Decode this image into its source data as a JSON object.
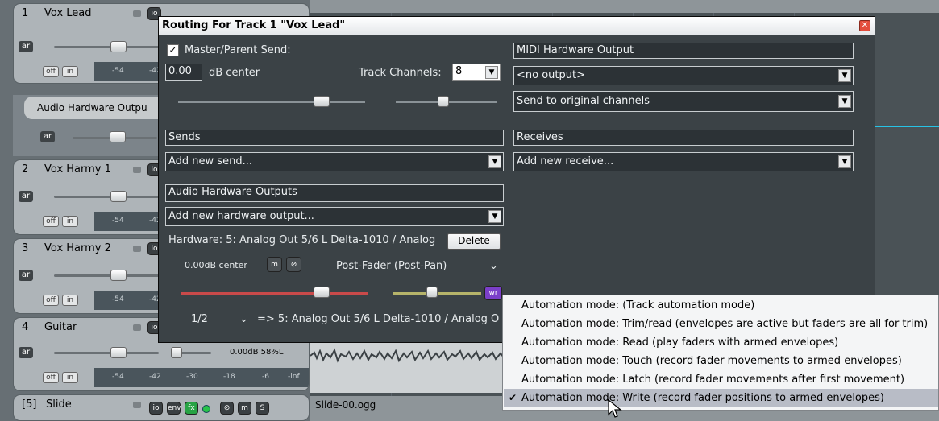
{
  "tracks": [
    {
      "num": "1",
      "name": "Vox Lead",
      "ar": "ar",
      "off": "off",
      "in": "in",
      "t1": "-54",
      "t2": "-42"
    },
    {
      "num": "2",
      "name": "Vox Harmy 1",
      "ar": "ar",
      "off": "off",
      "in": "in",
      "t1": "-54",
      "t2": "-42"
    },
    {
      "num": "3",
      "name": "Vox Harmy 2",
      "ar": "ar",
      "off": "off",
      "in": "in",
      "t1": "-54",
      "t2": "-42"
    },
    {
      "num": "4",
      "name": "Guitar",
      "ar": "ar",
      "off": "off",
      "in": "in",
      "meter": [
        "-54",
        "-42",
        "-30",
        "-18",
        "-6",
        "-inf"
      ],
      "vol": "0.00dB 58%L"
    },
    {
      "num": "[5]",
      "name": "Slide",
      "buttons": [
        "io",
        "env",
        "fx",
        "m",
        "S"
      ]
    }
  ],
  "hw_label": "Audio Hardware Outpu",
  "hw_ar": "ar",
  "slide_item": "Slide-00.ogg",
  "dialog": {
    "title": "Routing For Track 1 \"Vox Lead\"",
    "close": "✕",
    "master_send": "Master/Parent Send:",
    "vol_value": "0.00",
    "vol_unit": "dB  center",
    "track_channels_label": "Track Channels:",
    "track_channels": "8",
    "midi_hw_label": "MIDI Hardware Output",
    "midi_output": "<no output>",
    "midi_channels": "Send to original channels",
    "sends_label": "Sends",
    "sends_dd": "Add new send...",
    "receives_label": "Receives",
    "receives_dd": "Add new receive...",
    "audio_hw_label": "Audio Hardware Outputs",
    "audio_hw_dd": "Add new hardware output...",
    "hw_line": "Hardware: 5: Analog Out 5/6 L Delta-1010 / Analog",
    "delete": "Delete",
    "hw_vol": "0.00dB center",
    "m": "m",
    "postfader": "Post-Fader (Post-Pan)",
    "wr": "wr",
    "ch": "1/2",
    "route": "=> 5: Analog Out 5/6 L Delta-1010 / Analog O"
  },
  "menu": [
    {
      "label": "Automation mode: (Track automation mode)",
      "checked": false
    },
    {
      "label": "Automation mode: Trim/read (envelopes are active but faders are all for trim)",
      "checked": false
    },
    {
      "label": "Automation mode: Read (play faders with armed envelopes)",
      "checked": false
    },
    {
      "label": "Automation mode: Touch (record fader movements to armed envelopes)",
      "checked": false
    },
    {
      "label": "Automation mode: Latch (record fader movements after first movement)",
      "checked": false
    },
    {
      "label": "Automation mode: Write (record fader positions to armed envelopes)",
      "checked": true
    }
  ],
  "colors": {
    "dialog_bg": "#3b4246",
    "accent_cyan": "#27c3e6",
    "fx_green": "#27a344",
    "wr_purple": "#7b3fc9"
  }
}
